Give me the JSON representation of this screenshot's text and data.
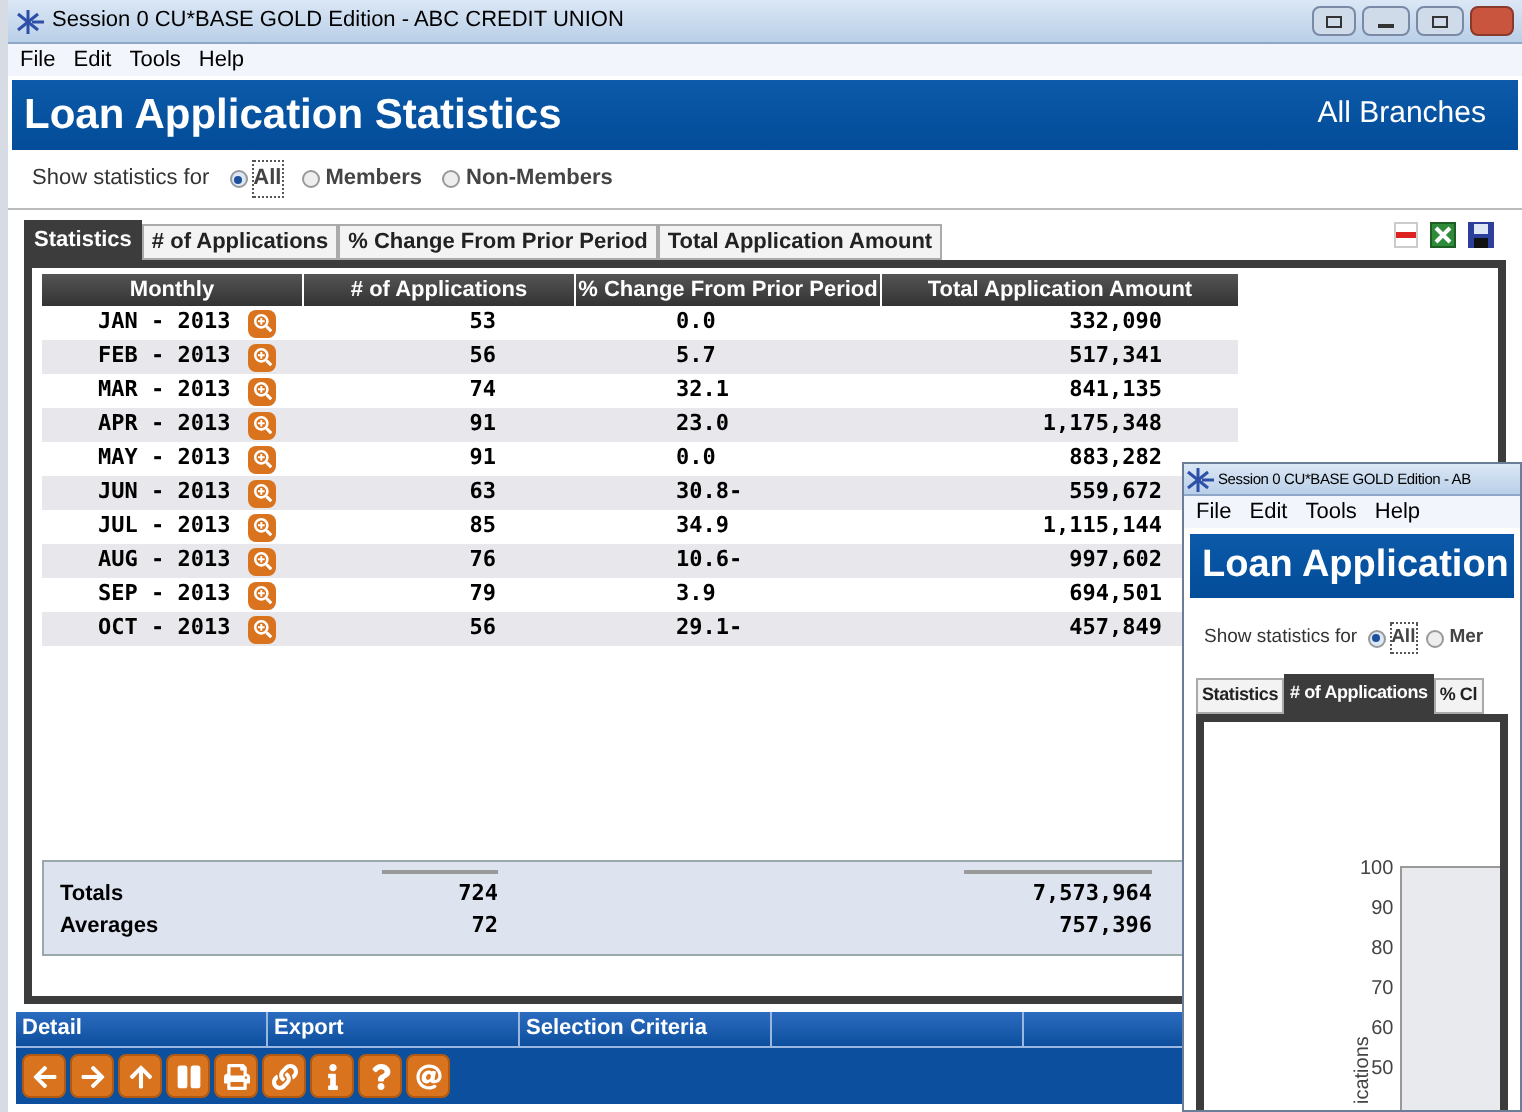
{
  "window": {
    "title": "Session 0 CU*BASE GOLD Edition - ABC CREDIT UNION"
  },
  "menu": [
    "File",
    "Edit",
    "Tools",
    "Help"
  ],
  "header": {
    "title": "Loan Application Statistics",
    "scope": "All Branches"
  },
  "filter": {
    "label": "Show statistics for",
    "options": [
      {
        "label": "All",
        "selected": true
      },
      {
        "label": "Members",
        "selected": false
      },
      {
        "label": "Non-Members",
        "selected": false
      }
    ]
  },
  "tabs": [
    {
      "label": "Statistics",
      "selected": true
    },
    {
      "label": "# of Applications",
      "selected": false
    },
    {
      "label": "% Change From Prior Period",
      "selected": false
    },
    {
      "label": "Total Application Amount",
      "selected": false
    }
  ],
  "table": {
    "columns": [
      "Monthly",
      "# of Applications",
      "% Change From Prior Period",
      "Total Application Amount"
    ],
    "rows": [
      {
        "month": "JAN - 2013",
        "applications": "53",
        "change": "0.0",
        "amount": "332,090"
      },
      {
        "month": "FEB - 2013",
        "applications": "56",
        "change": "5.7",
        "amount": "517,341"
      },
      {
        "month": "MAR - 2013",
        "applications": "74",
        "change": "32.1",
        "amount": "841,135"
      },
      {
        "month": "APR - 2013",
        "applications": "91",
        "change": "23.0",
        "amount": "1,175,348"
      },
      {
        "month": "MAY - 2013",
        "applications": "91",
        "change": "0.0",
        "amount": "883,282"
      },
      {
        "month": "JUN - 2013",
        "applications": "63",
        "change": "30.8-",
        "amount": "559,672"
      },
      {
        "month": "JUL - 2013",
        "applications": "85",
        "change": "34.9",
        "amount": "1,115,144"
      },
      {
        "month": "AUG - 2013",
        "applications": "76",
        "change": "10.6-",
        "amount": "997,602"
      },
      {
        "month": "SEP - 2013",
        "applications": "79",
        "change": "3.9",
        "amount": "694,501"
      },
      {
        "month": "OCT - 2013",
        "applications": "56",
        "change": "29.1-",
        "amount": "457,849"
      }
    ]
  },
  "summary": [
    {
      "label": "Totals",
      "applications": "724",
      "amount": "7,573,964"
    },
    {
      "label": "Averages",
      "applications": "72",
      "amount": "757,396"
    }
  ],
  "actions": [
    "Detail",
    "Export",
    "Selection Criteria"
  ],
  "toolbar": [
    {
      "kind": "back"
    },
    {
      "kind": "forward"
    },
    {
      "kind": "up"
    },
    {
      "kind": "pause"
    },
    {
      "kind": "print"
    },
    {
      "kind": "link"
    },
    {
      "kind": "info"
    },
    {
      "kind": "help"
    },
    {
      "kind": "email"
    }
  ],
  "second_window": {
    "title": "Session 0 CU*BASE GOLD Edition - AB",
    "menu": [
      "File",
      "Edit",
      "Tools",
      "Help"
    ],
    "header": "Loan Application",
    "filter": {
      "label": "Show statistics for",
      "options": [
        {
          "label": "All",
          "selected": true
        },
        {
          "label": "Mer",
          "selected": false
        }
      ]
    },
    "tabs": [
      {
        "label": "Statistics",
        "selected": false
      },
      {
        "label": "# of Applications",
        "selected": true
      },
      {
        "label": "% Cl",
        "selected": false
      }
    ],
    "chart_frame": {
      "yticks": [
        "100",
        "90",
        "80",
        "70",
        "60",
        "50"
      ],
      "ylabel": "ications"
    }
  }
}
